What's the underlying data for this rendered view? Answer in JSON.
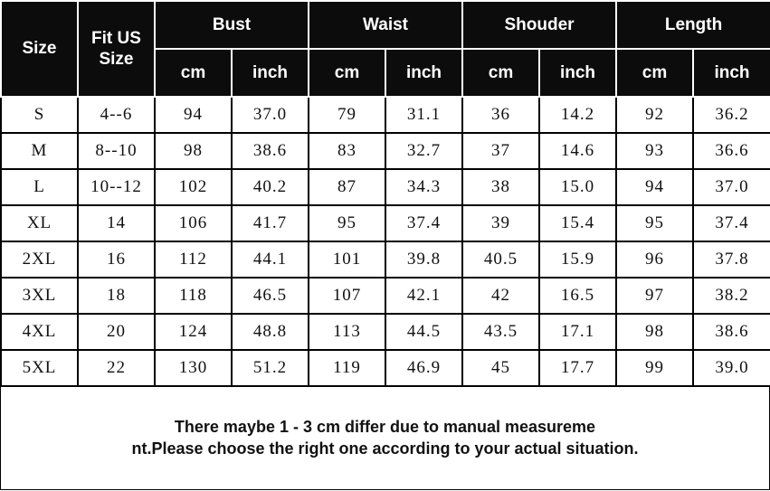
{
  "header": {
    "size": "Size",
    "fit_us_size": "Fit US Size",
    "groups": [
      "Bust",
      "Waist",
      "Shouder",
      "Length"
    ],
    "units": [
      "cm",
      "inch"
    ]
  },
  "rows": [
    [
      "S",
      "4--6",
      "94",
      "37.0",
      "79",
      "31.1",
      "36",
      "14.2",
      "92",
      "36.2"
    ],
    [
      "M",
      "8--10",
      "98",
      "38.6",
      "83",
      "32.7",
      "37",
      "14.6",
      "93",
      "36.6"
    ],
    [
      "L",
      "10--12",
      "102",
      "40.2",
      "87",
      "34.3",
      "38",
      "15.0",
      "94",
      "37.0"
    ],
    [
      "XL",
      "14",
      "106",
      "41.7",
      "95",
      "37.4",
      "39",
      "15.4",
      "95",
      "37.4"
    ],
    [
      "2XL",
      "16",
      "112",
      "44.1",
      "101",
      "39.8",
      "40.5",
      "15.9",
      "96",
      "37.8"
    ],
    [
      "3XL",
      "18",
      "118",
      "46.5",
      "107",
      "42.1",
      "42",
      "16.5",
      "97",
      "38.2"
    ],
    [
      "4XL",
      "20",
      "124",
      "48.8",
      "113",
      "44.5",
      "43.5",
      "17.1",
      "98",
      "38.6"
    ],
    [
      "5XL",
      "22",
      "130",
      "51.2",
      "119",
      "46.9",
      "45",
      "17.7",
      "99",
      "39.0"
    ]
  ],
  "note": {
    "line1": "There maybe 1 - 3 cm differ due to manual measureme",
    "line2": "nt.Please choose the right one according to your actual situation."
  }
}
